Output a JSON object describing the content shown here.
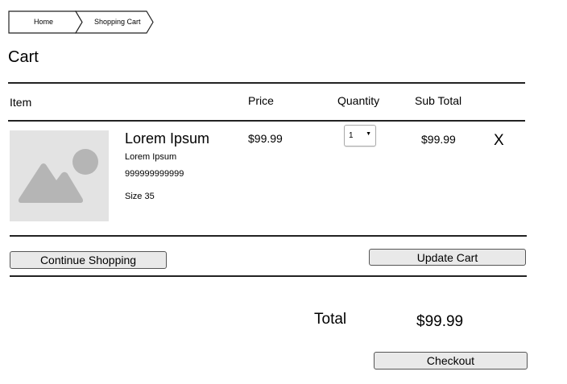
{
  "breadcrumb": {
    "items": [
      "Home",
      "Shopping Cart"
    ]
  },
  "page_title": "Cart",
  "table_headers": {
    "item": "Item",
    "price": "Price",
    "quantity": "Quantity",
    "subtotal": "Sub Total"
  },
  "cart_items": [
    {
      "name": "Lorem Ipsum",
      "description": "Lorem Ipsum",
      "sku": "999999999999",
      "size": "Size 35",
      "price": "$99.99",
      "quantity": "1",
      "subtotal": "$99.99",
      "remove_label": "X"
    }
  ],
  "buttons": {
    "continue_shopping": "Continue Shopping",
    "update_cart": "Update Cart",
    "checkout": "Checkout"
  },
  "summary": {
    "total_label": "Total",
    "total_value": "$99.99"
  },
  "icons": {
    "product_image": "image-placeholder-icon",
    "dropdown": "dropdown-arrow-icon"
  }
}
